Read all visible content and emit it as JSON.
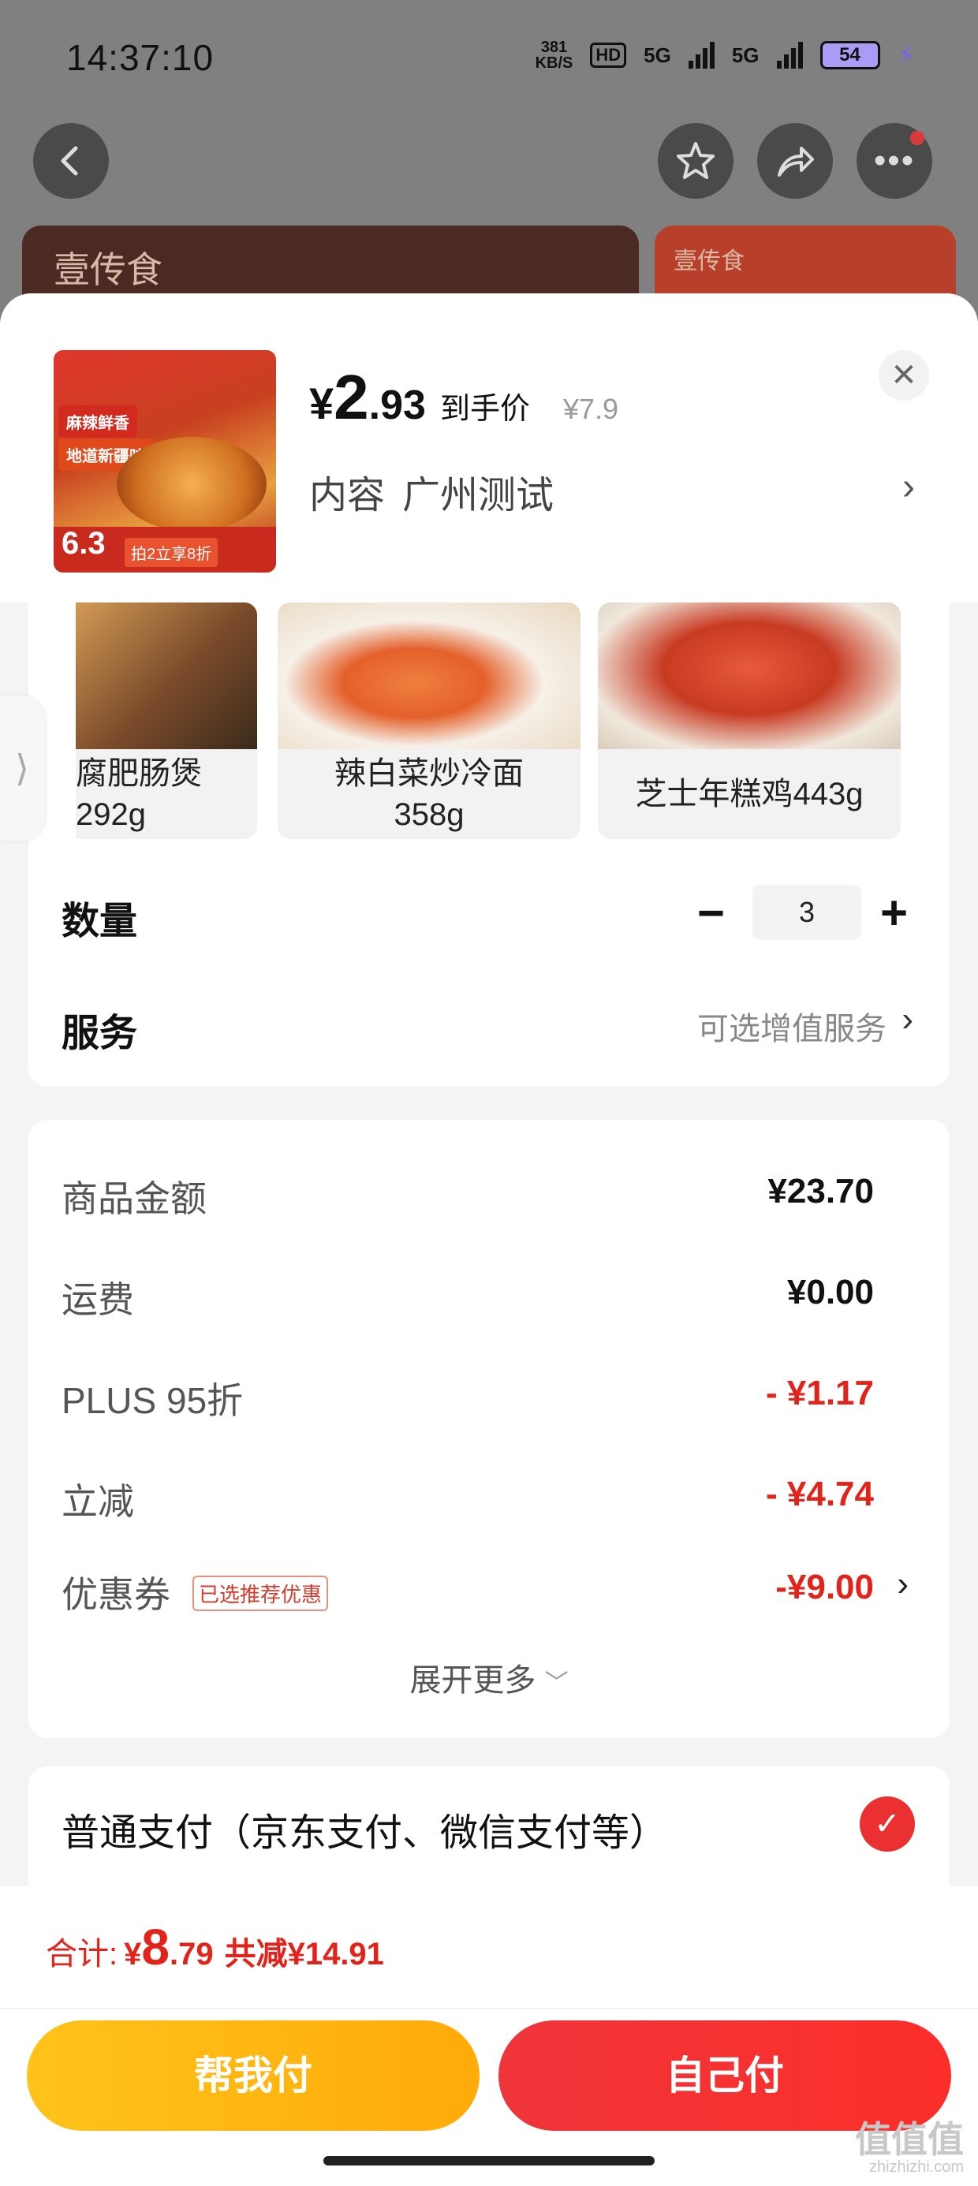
{
  "status_bar": {
    "time": "14:37:10",
    "net_speed_value": "381",
    "net_speed_unit": "KB/S",
    "hd_label": "HD",
    "signal_1": "5G",
    "signal_2": "5G",
    "battery": "54"
  },
  "background_page": {
    "banner_logo": "壹传食",
    "banner_logo_small": "壹传食"
  },
  "product": {
    "price_yen": "¥",
    "price_int": "2",
    "price_dec": ".93",
    "price_label": "到手价",
    "original_price": "¥7.9",
    "variant_label": "内容",
    "variant_value": "广州测试",
    "thumb_texts": {
      "tag1": "麻辣鲜香",
      "tag2": "地道新疆味",
      "promo_price": "6.3",
      "promo": "拍2立享8折"
    }
  },
  "variants": [
    {
      "name": "腐肥肠煲\n292g",
      "color": "#7a4a2a"
    },
    {
      "name": "辣白菜炒冷面\n358g",
      "color": "#e46a3a"
    },
    {
      "name": "芝士年糕鸡443g",
      "color": "#c83a22"
    }
  ],
  "quantity": {
    "label": "数量",
    "value": "3",
    "minus": "−",
    "plus": "+"
  },
  "service": {
    "label": "服务",
    "hint": "可选增值服务"
  },
  "summary": {
    "goods_label": "商品金额",
    "goods_value": "¥23.70",
    "shipping_label": "运费",
    "shipping_value": "¥0.00",
    "plus_label": "PLUS 95折",
    "plus_value": "- ¥1.17",
    "instant_label": "立减",
    "instant_value": "- ¥4.74",
    "coupon_label": "优惠券",
    "coupon_tag": "已选推荐优惠",
    "coupon_value": "-¥9.00",
    "expand": "展开更多"
  },
  "payment": {
    "label": "普通支付（京东支付、微信支付等）",
    "selected": true
  },
  "total": {
    "label": "合计:",
    "yen": "¥",
    "int": "8",
    "dec": ".79",
    "saved": "共减¥14.91"
  },
  "buttons": {
    "help_pay": "帮我付",
    "self_pay": "自己付"
  },
  "watermark": {
    "text": "值值值",
    "domain": "zhizhizhi.com"
  },
  "colors": {
    "accent_red": "#e2231a",
    "help_btn": "#ffb80f",
    "self_btn": "#f33233"
  }
}
